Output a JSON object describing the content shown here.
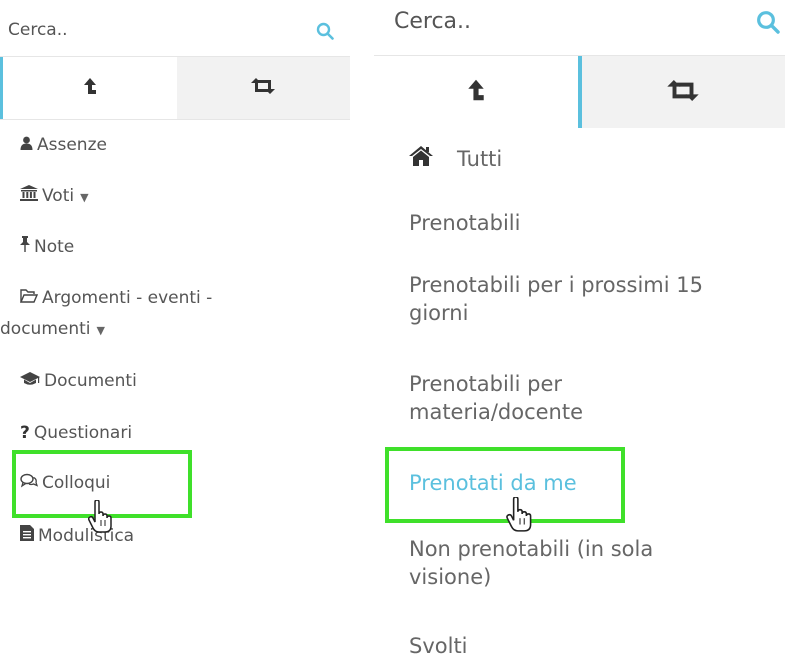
{
  "left_panel": {
    "search": {
      "placeholder": "Cerca.."
    },
    "menu": [
      {
        "label": "Assenze",
        "icon": "user-icon"
      },
      {
        "label": "Voti",
        "icon": "institution-icon",
        "caret": "▼"
      },
      {
        "label": "Note",
        "icon": "pin-icon"
      },
      {
        "label": "Argomenti - eventi -",
        "label2": "documenti",
        "icon": "folder-open-icon",
        "caret": "▼"
      },
      {
        "label": "Documenti",
        "icon": "graduation-cap-icon"
      },
      {
        "label": "Questionari",
        "icon": "question-icon"
      },
      {
        "label": "Colloqui",
        "icon": "comments-icon"
      },
      {
        "label": "Modulistica",
        "icon": "file-icon"
      }
    ]
  },
  "right_panel": {
    "search": {
      "placeholder": "Cerca.."
    },
    "menu": [
      {
        "label": "Tutti",
        "icon": "home-icon"
      },
      {
        "label": "Prenotabili"
      },
      {
        "label": "Prenotabili per i prossimi 15",
        "label2": "giorni"
      },
      {
        "label": "Prenotabili per",
        "label2": "materia/docente"
      },
      {
        "label": "Prenotati da me",
        "active": true
      },
      {
        "label": "Non prenotabili (in sola",
        "label2": "visione)"
      },
      {
        "label": "Svolti"
      }
    ]
  },
  "colors": {
    "accent": "#5bc0de",
    "highlight": "#3fe02a"
  }
}
